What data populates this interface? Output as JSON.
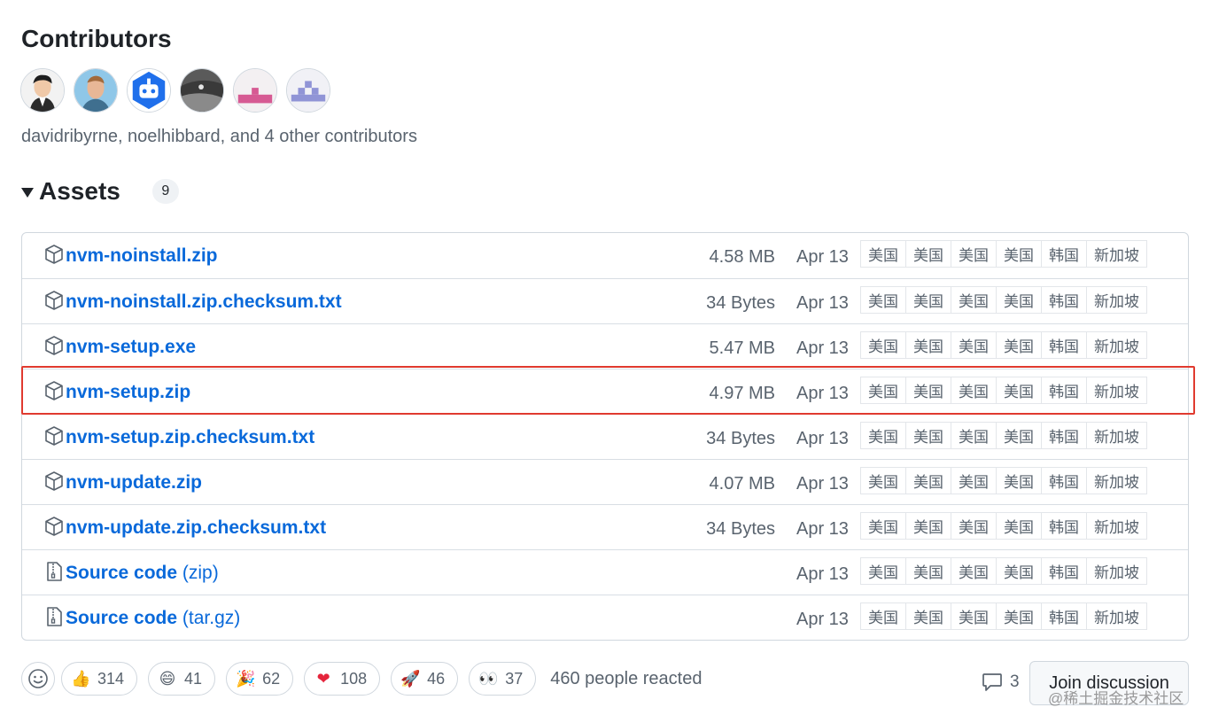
{
  "contributors": {
    "title": "Contributors",
    "avatars": [
      "david-avatar",
      "noel-avatar",
      "bot-avatar",
      "landscape-avatar",
      "identicon-pink-avatar",
      "identicon-purple-avatar"
    ],
    "summary": "davidribyrne, noelhibbard, and 4 other contributors"
  },
  "assets": {
    "title": "Assets",
    "count": "9",
    "mirror_labels": [
      "美国",
      "美国",
      "美国",
      "美国",
      "韩国",
      "新加坡"
    ],
    "rows": [
      {
        "name": "nvm-noinstall.zip",
        "sub": "",
        "size": "4.58 MB",
        "date": "Apr 13",
        "icon": "package-icon"
      },
      {
        "name": "nvm-noinstall.zip.checksum.txt",
        "sub": "",
        "size": "34 Bytes",
        "date": "Apr 13",
        "icon": "package-icon"
      },
      {
        "name": "nvm-setup.exe",
        "sub": "",
        "size": "5.47 MB",
        "date": "Apr 13",
        "icon": "package-icon"
      },
      {
        "name": "nvm-setup.zip",
        "sub": "",
        "size": "4.97 MB",
        "date": "Apr 13",
        "icon": "package-icon",
        "highlighted": true
      },
      {
        "name": "nvm-setup.zip.checksum.txt",
        "sub": "",
        "size": "34 Bytes",
        "date": "Apr 13",
        "icon": "package-icon"
      },
      {
        "name": "nvm-update.zip",
        "sub": "",
        "size": "4.07 MB",
        "date": "Apr 13",
        "icon": "package-icon"
      },
      {
        "name": "nvm-update.zip.checksum.txt",
        "sub": "",
        "size": "34 Bytes",
        "date": "Apr 13",
        "icon": "package-icon"
      },
      {
        "name": "Source code",
        "sub": "(zip)",
        "size": "",
        "date": "Apr 13",
        "icon": "file-zip-icon"
      },
      {
        "name": "Source code",
        "sub": "(tar.gz)",
        "size": "",
        "date": "Apr 13",
        "icon": "file-zip-icon"
      }
    ]
  },
  "reactions": {
    "items": [
      {
        "emoji": "👍",
        "icon": "thumbs-up-icon",
        "count": "314"
      },
      {
        "emoji": "😄",
        "icon": "laugh-icon",
        "count": "41"
      },
      {
        "emoji": "🎉",
        "icon": "hooray-icon",
        "count": "62"
      },
      {
        "emoji": "❤",
        "icon": "heart-icon",
        "count": "108"
      },
      {
        "emoji": "🚀",
        "icon": "rocket-icon",
        "count": "46"
      },
      {
        "emoji": "👀",
        "icon": "eyes-icon",
        "count": "37"
      }
    ],
    "summary": "460 people reacted"
  },
  "discussion": {
    "comment_count": "3",
    "join_label": "Join discussion"
  },
  "watermark": "@稀土掘金技术社区",
  "colors": {
    "link": "#0969da",
    "muted": "#59636e",
    "highlight_border": "#e03a2f"
  }
}
